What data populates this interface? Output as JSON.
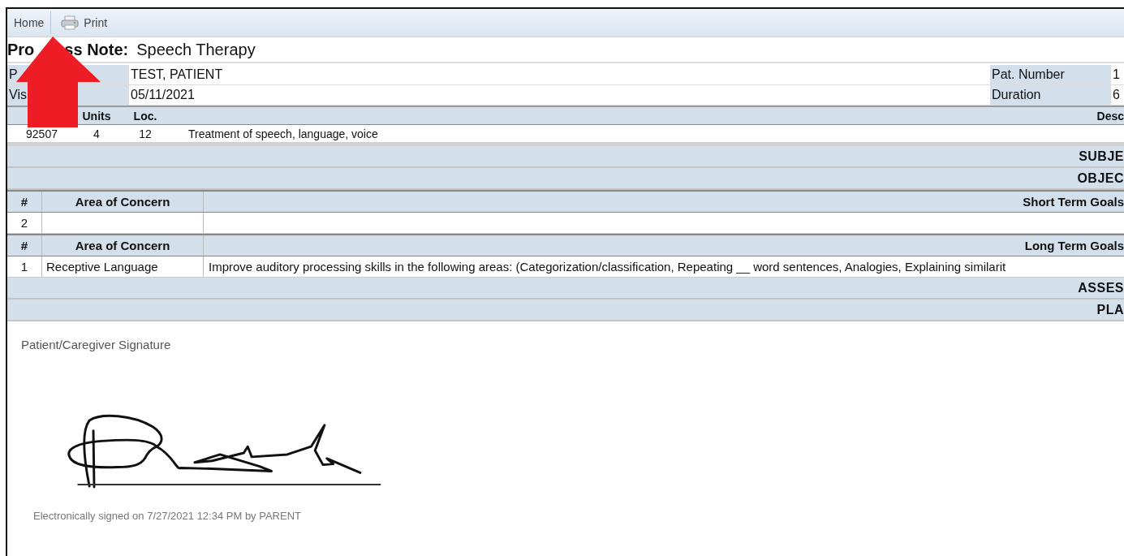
{
  "toolbar": {
    "items": [
      {
        "label": "Home",
        "kind": "text"
      },
      {
        "label": "Print",
        "kind": "print"
      }
    ]
  },
  "title": {
    "parts": [
      "Pro",
      "ss Note:"
    ],
    "subject": "Speech Therapy"
  },
  "info": {
    "rows": [
      {
        "label": "P",
        "value": "TEST, PATIENT",
        "label_2": "Pat. Number",
        "value_2": "1"
      },
      {
        "label": "Vis",
        "value": "05/11/2021",
        "label_2": "Duration",
        "value_2": "6"
      }
    ]
  },
  "procedures": {
    "columns": [
      "Units",
      "Loc.",
      "Desc"
    ],
    "rows": [
      {
        "code": "92507",
        "units": "4",
        "loc": "12",
        "description": "Treatment of speech, language, voice"
      }
    ]
  },
  "sections": [
    {
      "kind": "bar",
      "title": "SUBJE"
    },
    {
      "kind": "bar",
      "title": "OBJEC"
    },
    {
      "kind": "goals",
      "columns": [
        "#",
        "Area of Concern",
        "Short Term Goals"
      ],
      "rows": [
        {
          "number": "2",
          "area": "",
          "goal": ""
        }
      ]
    },
    {
      "kind": "goals",
      "columns": [
        "#",
        "Area of Concern",
        "Long Term Goals"
      ],
      "rows": [
        {
          "number": "1",
          "area": "Receptive Language",
          "goal": "Improve auditory processing skills in the following areas: (Categorization/classification, Repeating __ word sentences, Analogies, Explaining similarit"
        }
      ]
    },
    {
      "kind": "bar",
      "title": "ASSES"
    },
    {
      "kind": "bar",
      "title": "PLA"
    }
  ],
  "signature": {
    "label": "Patient/Caregiver Signature",
    "signed_text": "Electronically signed on 7/27/2021 12:34 PM by PARENT"
  },
  "annotation": {
    "kind": "up-arrow"
  }
}
